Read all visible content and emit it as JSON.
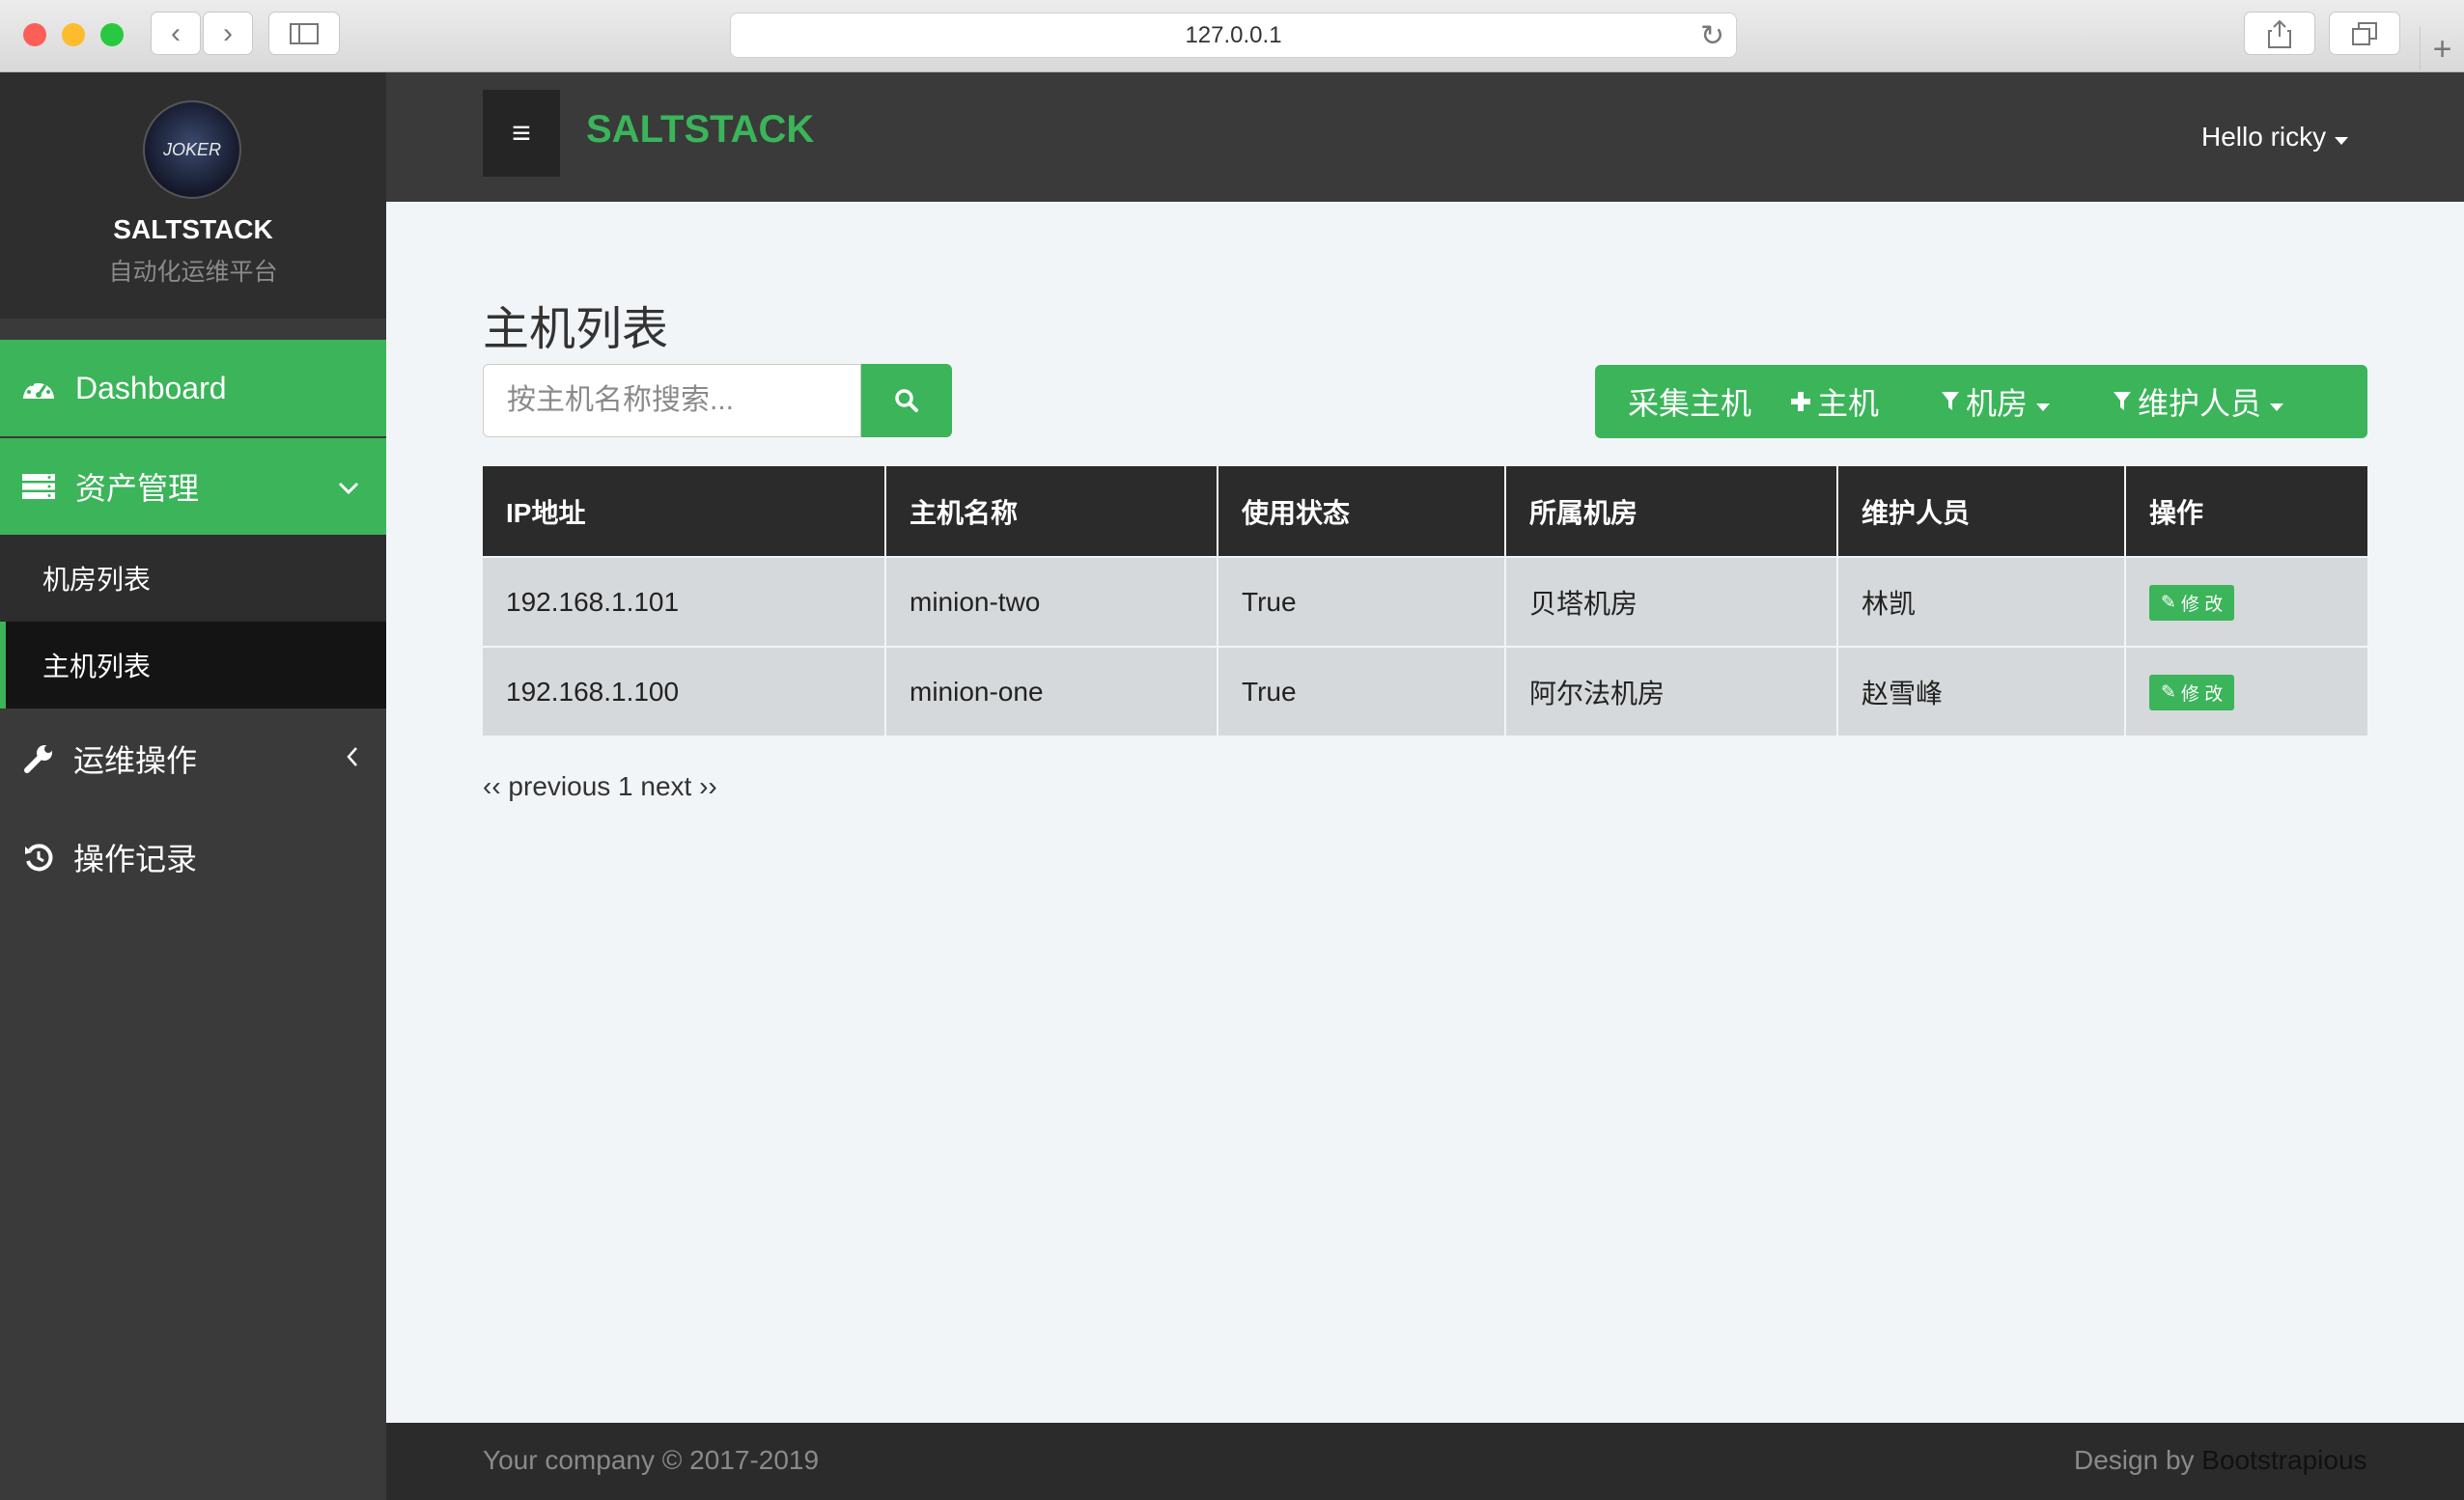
{
  "browser": {
    "url": "127.0.0.1"
  },
  "sidebar": {
    "brand_title": "SALTSTACK",
    "brand_subtitle": "自动化运维平台",
    "avatar_text": "JOKER",
    "items": [
      {
        "label": "Dashboard",
        "icon": "dashboard-icon"
      },
      {
        "label": "资产管理",
        "icon": "server-icon"
      },
      {
        "label": "机房列表"
      },
      {
        "label": "主机列表"
      },
      {
        "label": "运维操作",
        "icon": "wrench-icon"
      },
      {
        "label": "操作记录",
        "icon": "history-icon"
      }
    ]
  },
  "header": {
    "title": "SALTSTACK",
    "user": "Hello ricky"
  },
  "main": {
    "page_title": "主机列表",
    "search_placeholder": "按主机名称搜索...",
    "actions": {
      "collect": "采集主机",
      "add": "主机",
      "room": "机房",
      "maintainer": "维护人员"
    },
    "table": {
      "headers": [
        "IP地址",
        "主机名称",
        "使用状态",
        "所属机房",
        "维护人员",
        "操作"
      ],
      "rows": [
        {
          "ip": "192.168.1.101",
          "name": "minion-two",
          "status": "True",
          "room": "贝塔机房",
          "maintainer": "林凯",
          "action": "修 改"
        },
        {
          "ip": "192.168.1.100",
          "name": "minion-one",
          "status": "True",
          "room": "阿尔法机房",
          "maintainer": "赵雪峰",
          "action": "修 改"
        }
      ]
    },
    "pagination": {
      "previous": "‹‹ previous",
      "page": "1",
      "next": "next ››"
    }
  },
  "footer": {
    "left": "Your company © 2017-2019",
    "design_by": "Design by",
    "design_link": "Bootstrapious"
  },
  "colors": {
    "accent": "#3bb45a",
    "sidebar": "#3a3a3a",
    "topbar": "#3a3a3a",
    "table_header": "#2b2b2b"
  }
}
